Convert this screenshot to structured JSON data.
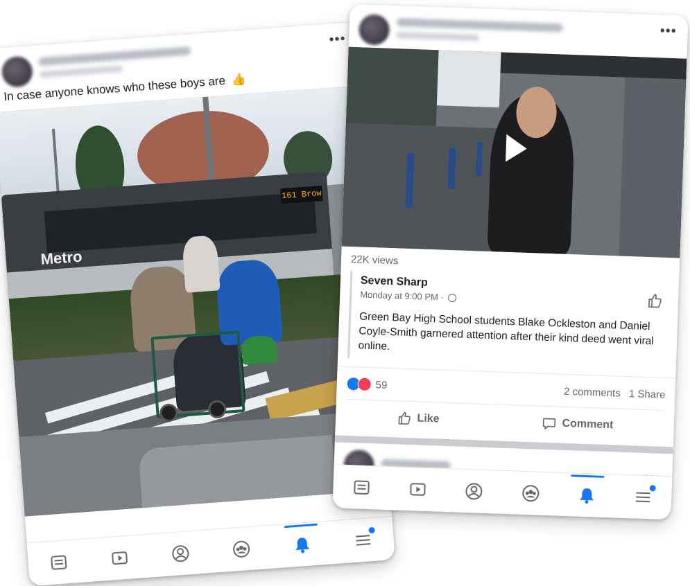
{
  "left_post": {
    "caption": "In case anyone knows who these boys are",
    "caption_emoji": "👍",
    "photo": {
      "bus_logo": "Metro",
      "bus_sign": "161 Brow"
    }
  },
  "right_post": {
    "views": "22K views",
    "shared_page": {
      "name": "Seven Sharp",
      "meta": "Monday at 9:00 PM ·",
      "text": "Green Bay High School students Blake Ockleston and Daniel Coyle-Smith garnered attention after their kind deed went viral online."
    },
    "reactions_count": "59",
    "comments": "2 comments",
    "shares": "1 Share",
    "actions": {
      "like": "Like",
      "comment": "Comment"
    }
  },
  "more_menu": "•••",
  "nav": {
    "items": [
      "feed-icon",
      "watch-icon",
      "profile-icon",
      "groups-icon",
      "notifications-icon",
      "menu-icon"
    ],
    "active": "notifications-icon"
  },
  "colors": {
    "accent": "#1877f2",
    "love": "#f33e58",
    "text_secondary": "#65676b"
  }
}
